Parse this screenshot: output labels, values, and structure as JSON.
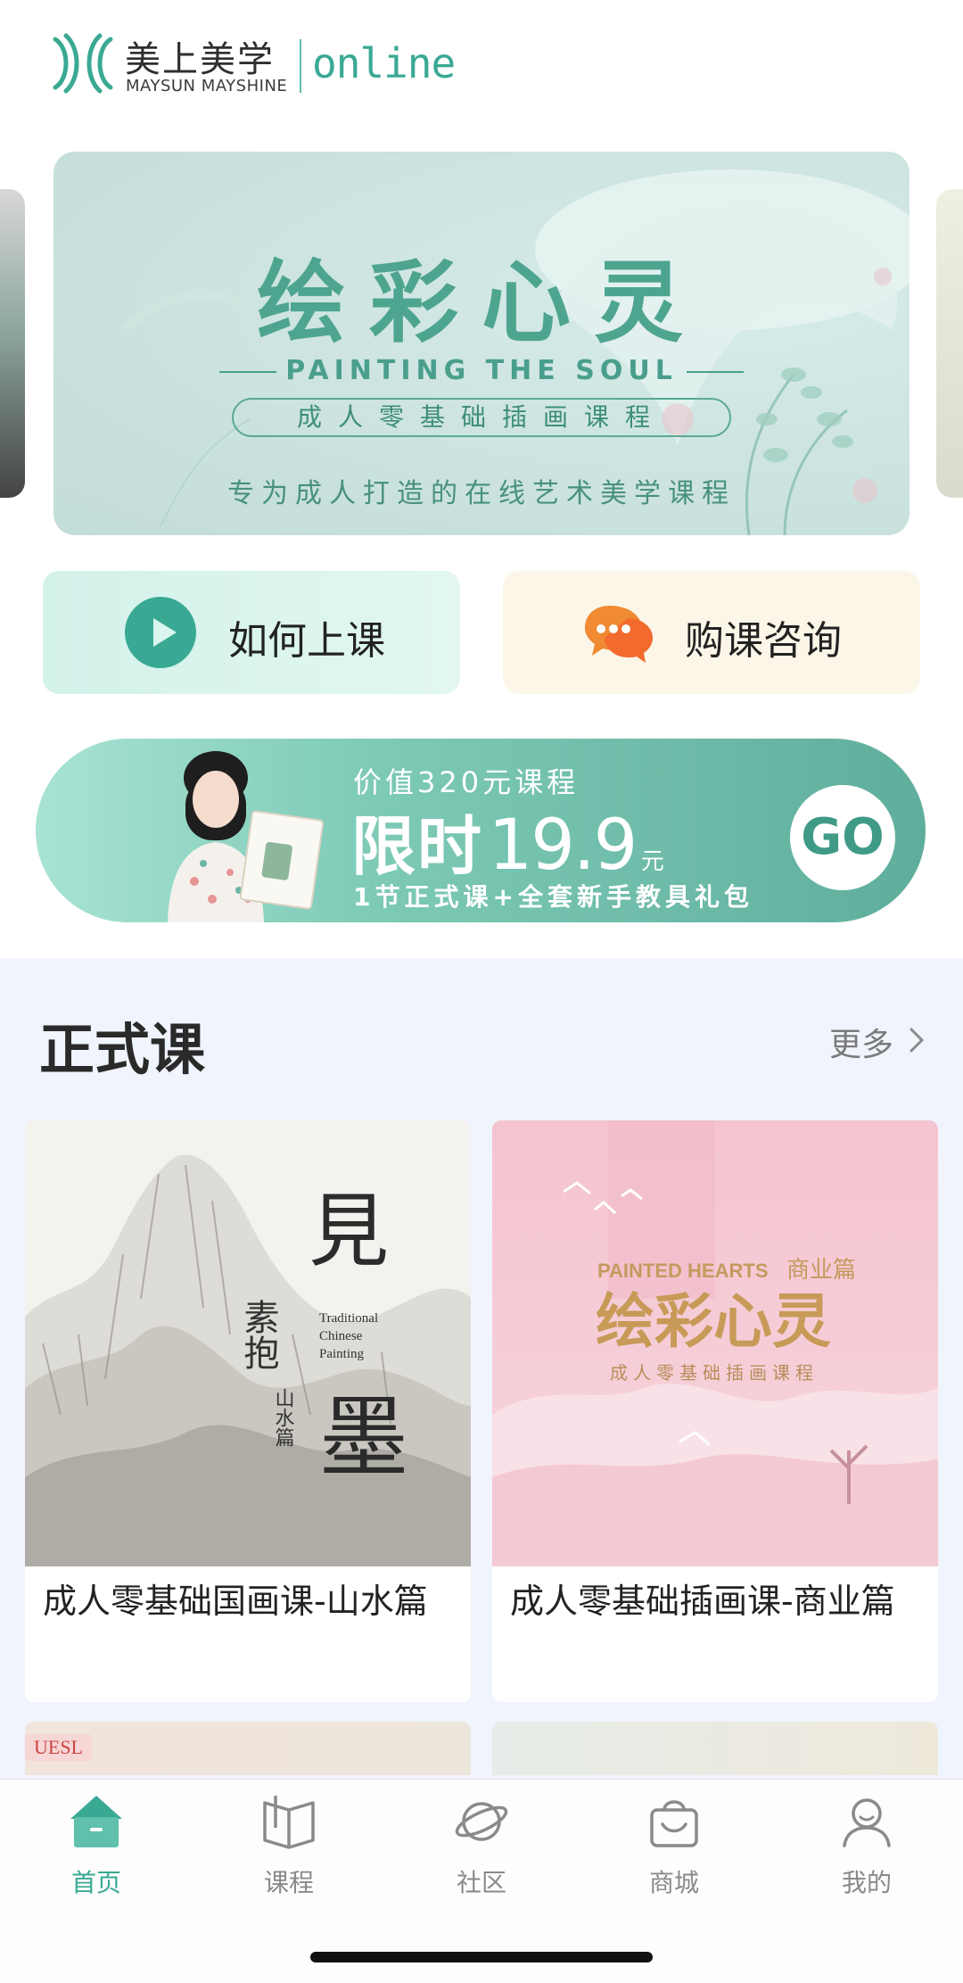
{
  "header": {
    "logo_cn": "美上美学",
    "logo_en": "MAYSUN MAYSHINE",
    "logo_online": "online"
  },
  "banner": {
    "title": "绘彩心灵",
    "subtitle_en": "PAINTING THE SOUL",
    "pill": "成人零基础插画课程",
    "description": "专为成人打造的在线艺术美学课程"
  },
  "quick_actions": {
    "how": {
      "label": "如何上课",
      "icon": "play-icon"
    },
    "buy": {
      "label": "购课咨询",
      "icon": "chat-bubble-icon"
    }
  },
  "promo": {
    "line1": "价值320元课程",
    "line2_prefix": "限时",
    "price": "19.9",
    "unit": "元",
    "line3": "1节正式课+全套新手教具礼包",
    "go": "GO"
  },
  "section": {
    "title": "正式课",
    "more": "更多"
  },
  "courses": [
    {
      "title": "成人零基础国画课-山水篇",
      "cover": {
        "big1": "見",
        "big2": "墨",
        "side": "素抱",
        "en1": "Traditional",
        "en2": "Chinese",
        "en3": "Painting",
        "vertical": "山水篇"
      }
    },
    {
      "title": "成人零基础插画课-商业篇",
      "cover": {
        "en": "PAINTED HEARTS",
        "tag": "商业篇",
        "title": "绘彩心灵",
        "sub": "成人零基础插画课程"
      }
    }
  ],
  "peek": {
    "tag": "UESL"
  },
  "bottom_nav": [
    {
      "label": "首页",
      "icon": "home-icon",
      "active": true
    },
    {
      "label": "课程",
      "icon": "book-icon",
      "active": false
    },
    {
      "label": "社区",
      "icon": "planet-icon",
      "active": false
    },
    {
      "label": "商城",
      "icon": "shopping-bag-icon",
      "active": false
    },
    {
      "label": "我的",
      "icon": "user-icon",
      "active": false
    }
  ],
  "colors": {
    "brand": "#3aa994",
    "banner_text": "#4ea58f",
    "section_bg": "#f0f4fc",
    "promo_accent": "#5fae9c"
  }
}
